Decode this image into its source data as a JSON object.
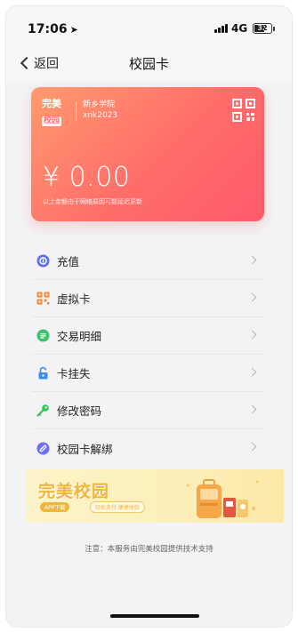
{
  "status": {
    "time": "17:06",
    "network": "4G",
    "battery": "32"
  },
  "nav": {
    "back_label": "返回",
    "title": "校园卡"
  },
  "card": {
    "logo_line1": "完美",
    "logo_line2": "校园",
    "school_name": "新乡学院",
    "username": "xnk2023",
    "balance": "¥ 0.00",
    "note": "以上金额由于网络原因可能延迟更新"
  },
  "menu": {
    "items": [
      {
        "label": "充值",
        "icon": "recharge-icon",
        "color": "#5b6ef5"
      },
      {
        "label": "虚拟卡",
        "icon": "qr-code-icon",
        "color": "#f08a3c"
      },
      {
        "label": "交易明细",
        "icon": "transaction-icon",
        "color": "#3cc46a"
      },
      {
        "label": "卡挂失",
        "icon": "lock-icon",
        "color": "#3b8cf0"
      },
      {
        "label": "修改密码",
        "icon": "key-icon",
        "color": "#34c05a"
      },
      {
        "label": "校园卡解绑",
        "icon": "unbind-icon",
        "color": "#6c6ef5"
      }
    ]
  },
  "banner": {
    "title": "完美校园",
    "tag1": "APP下载",
    "tag2": "轻松支付 便捷体验"
  },
  "footer": {
    "note": "注意：本服务由完美校园提供技术支持"
  },
  "colors": {
    "card_start": "#ff9a6e",
    "card_end": "#ff5a6a",
    "accent": "#f0b63c"
  }
}
